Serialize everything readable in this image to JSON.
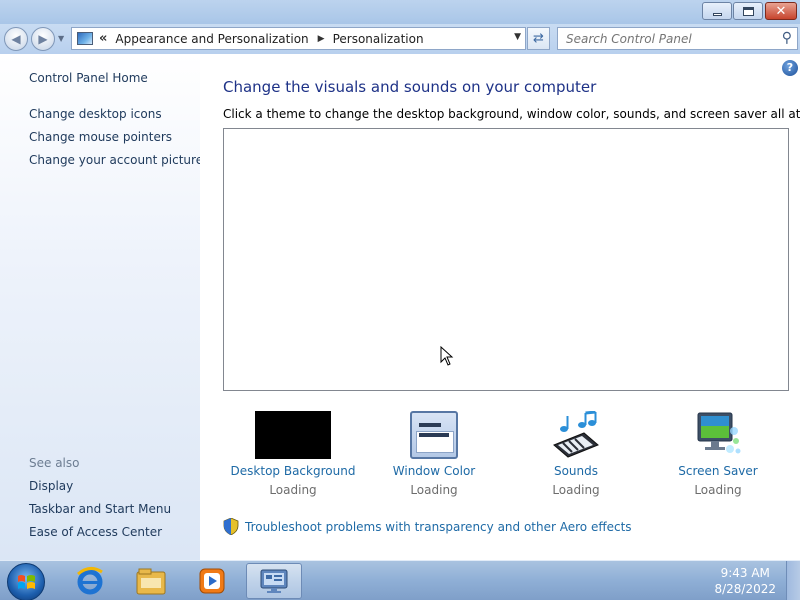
{
  "window": {
    "minimize_symbol": "–",
    "maximize_symbol": "□",
    "close_symbol": "✕"
  },
  "address_bar": {
    "chevron": "«",
    "crumbs": [
      "Appearance and Personalization",
      "Personalization"
    ],
    "separator": "▶",
    "dropdown": "▼"
  },
  "search": {
    "placeholder": "Search Control Panel"
  },
  "sidebar": {
    "home": "Control Panel Home",
    "tasks": [
      "Change desktop icons",
      "Change mouse pointers",
      "Change your account picture"
    ],
    "see_also_label": "See also",
    "see_also": [
      "Display",
      "Taskbar and Start Menu",
      "Ease of Access Center"
    ]
  },
  "main": {
    "help_symbol": "?",
    "title": "Change the visuals and sounds on your computer",
    "subtitle": "Click a theme to change the desktop background, window color, sounds, and screen saver all at once.",
    "tiles": [
      {
        "label": "Desktop Background",
        "status": "Loading",
        "icon": "desktop-background-thumbnail"
      },
      {
        "label": "Window Color",
        "status": "Loading",
        "icon": "window-color-icon"
      },
      {
        "label": "Sounds",
        "status": "Loading",
        "icon": "sounds-icon"
      },
      {
        "label": "Screen Saver",
        "status": "Loading",
        "icon": "screen-saver-icon"
      }
    ],
    "troubleshoot_link": "Troubleshoot problems with transparency and other Aero effects"
  },
  "taskbar": {
    "pinned": [
      "internet-explorer-icon",
      "windows-explorer-icon",
      "media-player-icon",
      "control-panel-icon"
    ],
    "clock": {
      "time": "9:43 AM",
      "date": "8/28/2022"
    }
  },
  "colors": {
    "link": "#1e6aa6",
    "heading": "#1e3287",
    "sidebar_text": "#1e395b"
  }
}
